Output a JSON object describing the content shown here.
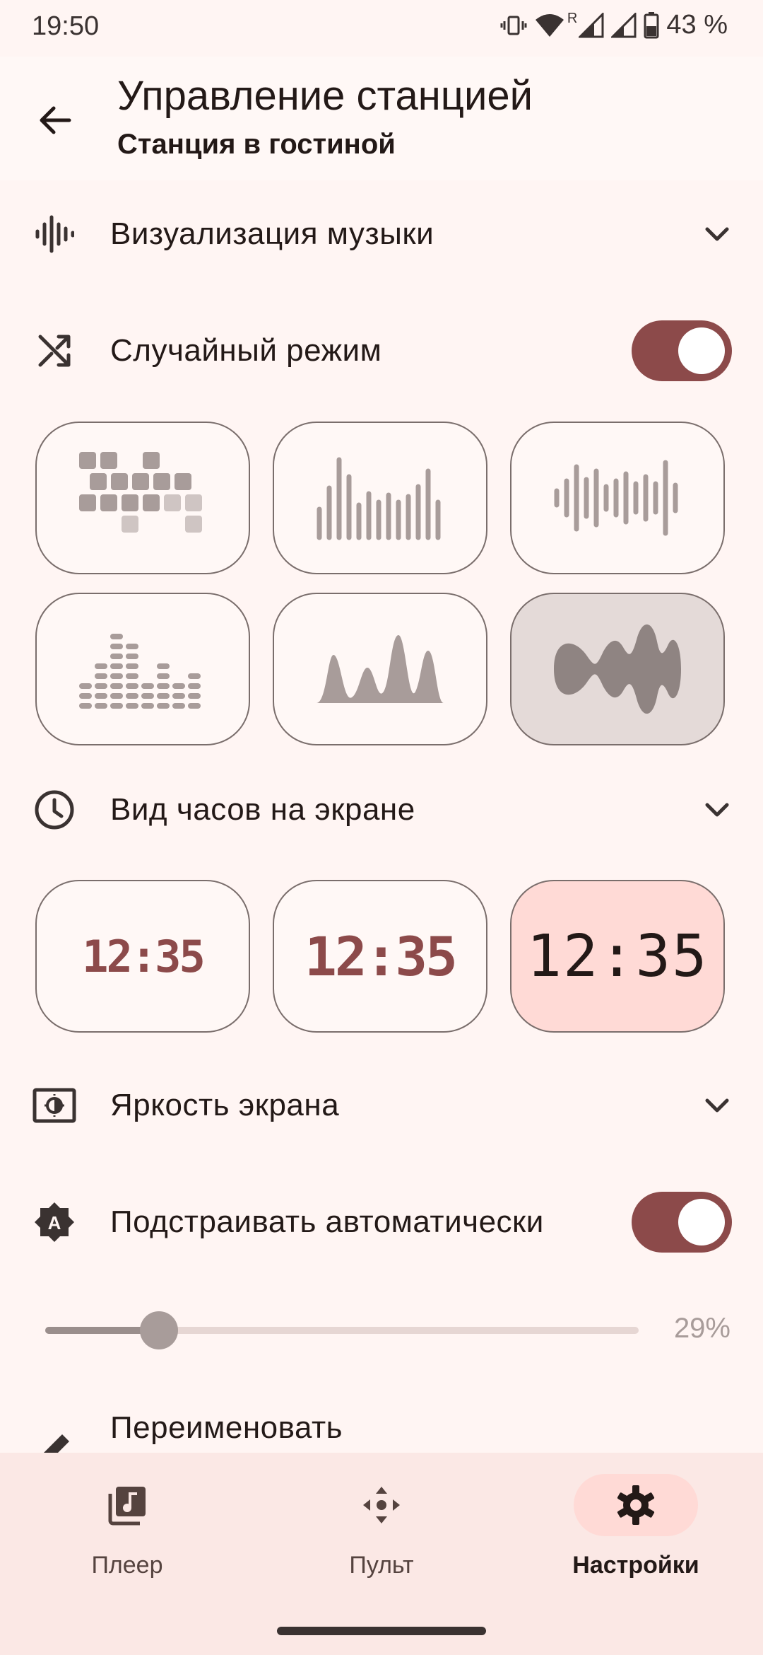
{
  "status_bar": {
    "time": "19:50",
    "battery": "43 %",
    "roaming": "R"
  },
  "header": {
    "title": "Управление станцией",
    "subtitle": "Станция в гостиной"
  },
  "sections": {
    "visualization": {
      "label": "Визуализация музыки"
    },
    "random_mode": {
      "label": "Случайный режим",
      "enabled": true
    },
    "clock_view": {
      "label": "Вид часов на экране"
    },
    "clock_options": [
      "12:35",
      "12:35",
      "12:35"
    ],
    "brightness": {
      "label": "Яркость экрана"
    },
    "auto_adjust": {
      "label": "Подстраивать автоматически",
      "enabled": true
    },
    "brightness_value": "29%",
    "brightness_level": 0.29,
    "rename": {
      "label": "Переименовать"
    }
  },
  "visualizations_selected_index": 5,
  "clock_selected_index": 2,
  "nav": {
    "player": "Плеер",
    "remote": "Пульт",
    "settings": "Настройки",
    "active": "settings"
  },
  "colors": {
    "accent": "#8c4a4a",
    "background": "#fff5f3",
    "selected_tile": "#e4dad8",
    "selected_clock": "#ffdad6"
  }
}
